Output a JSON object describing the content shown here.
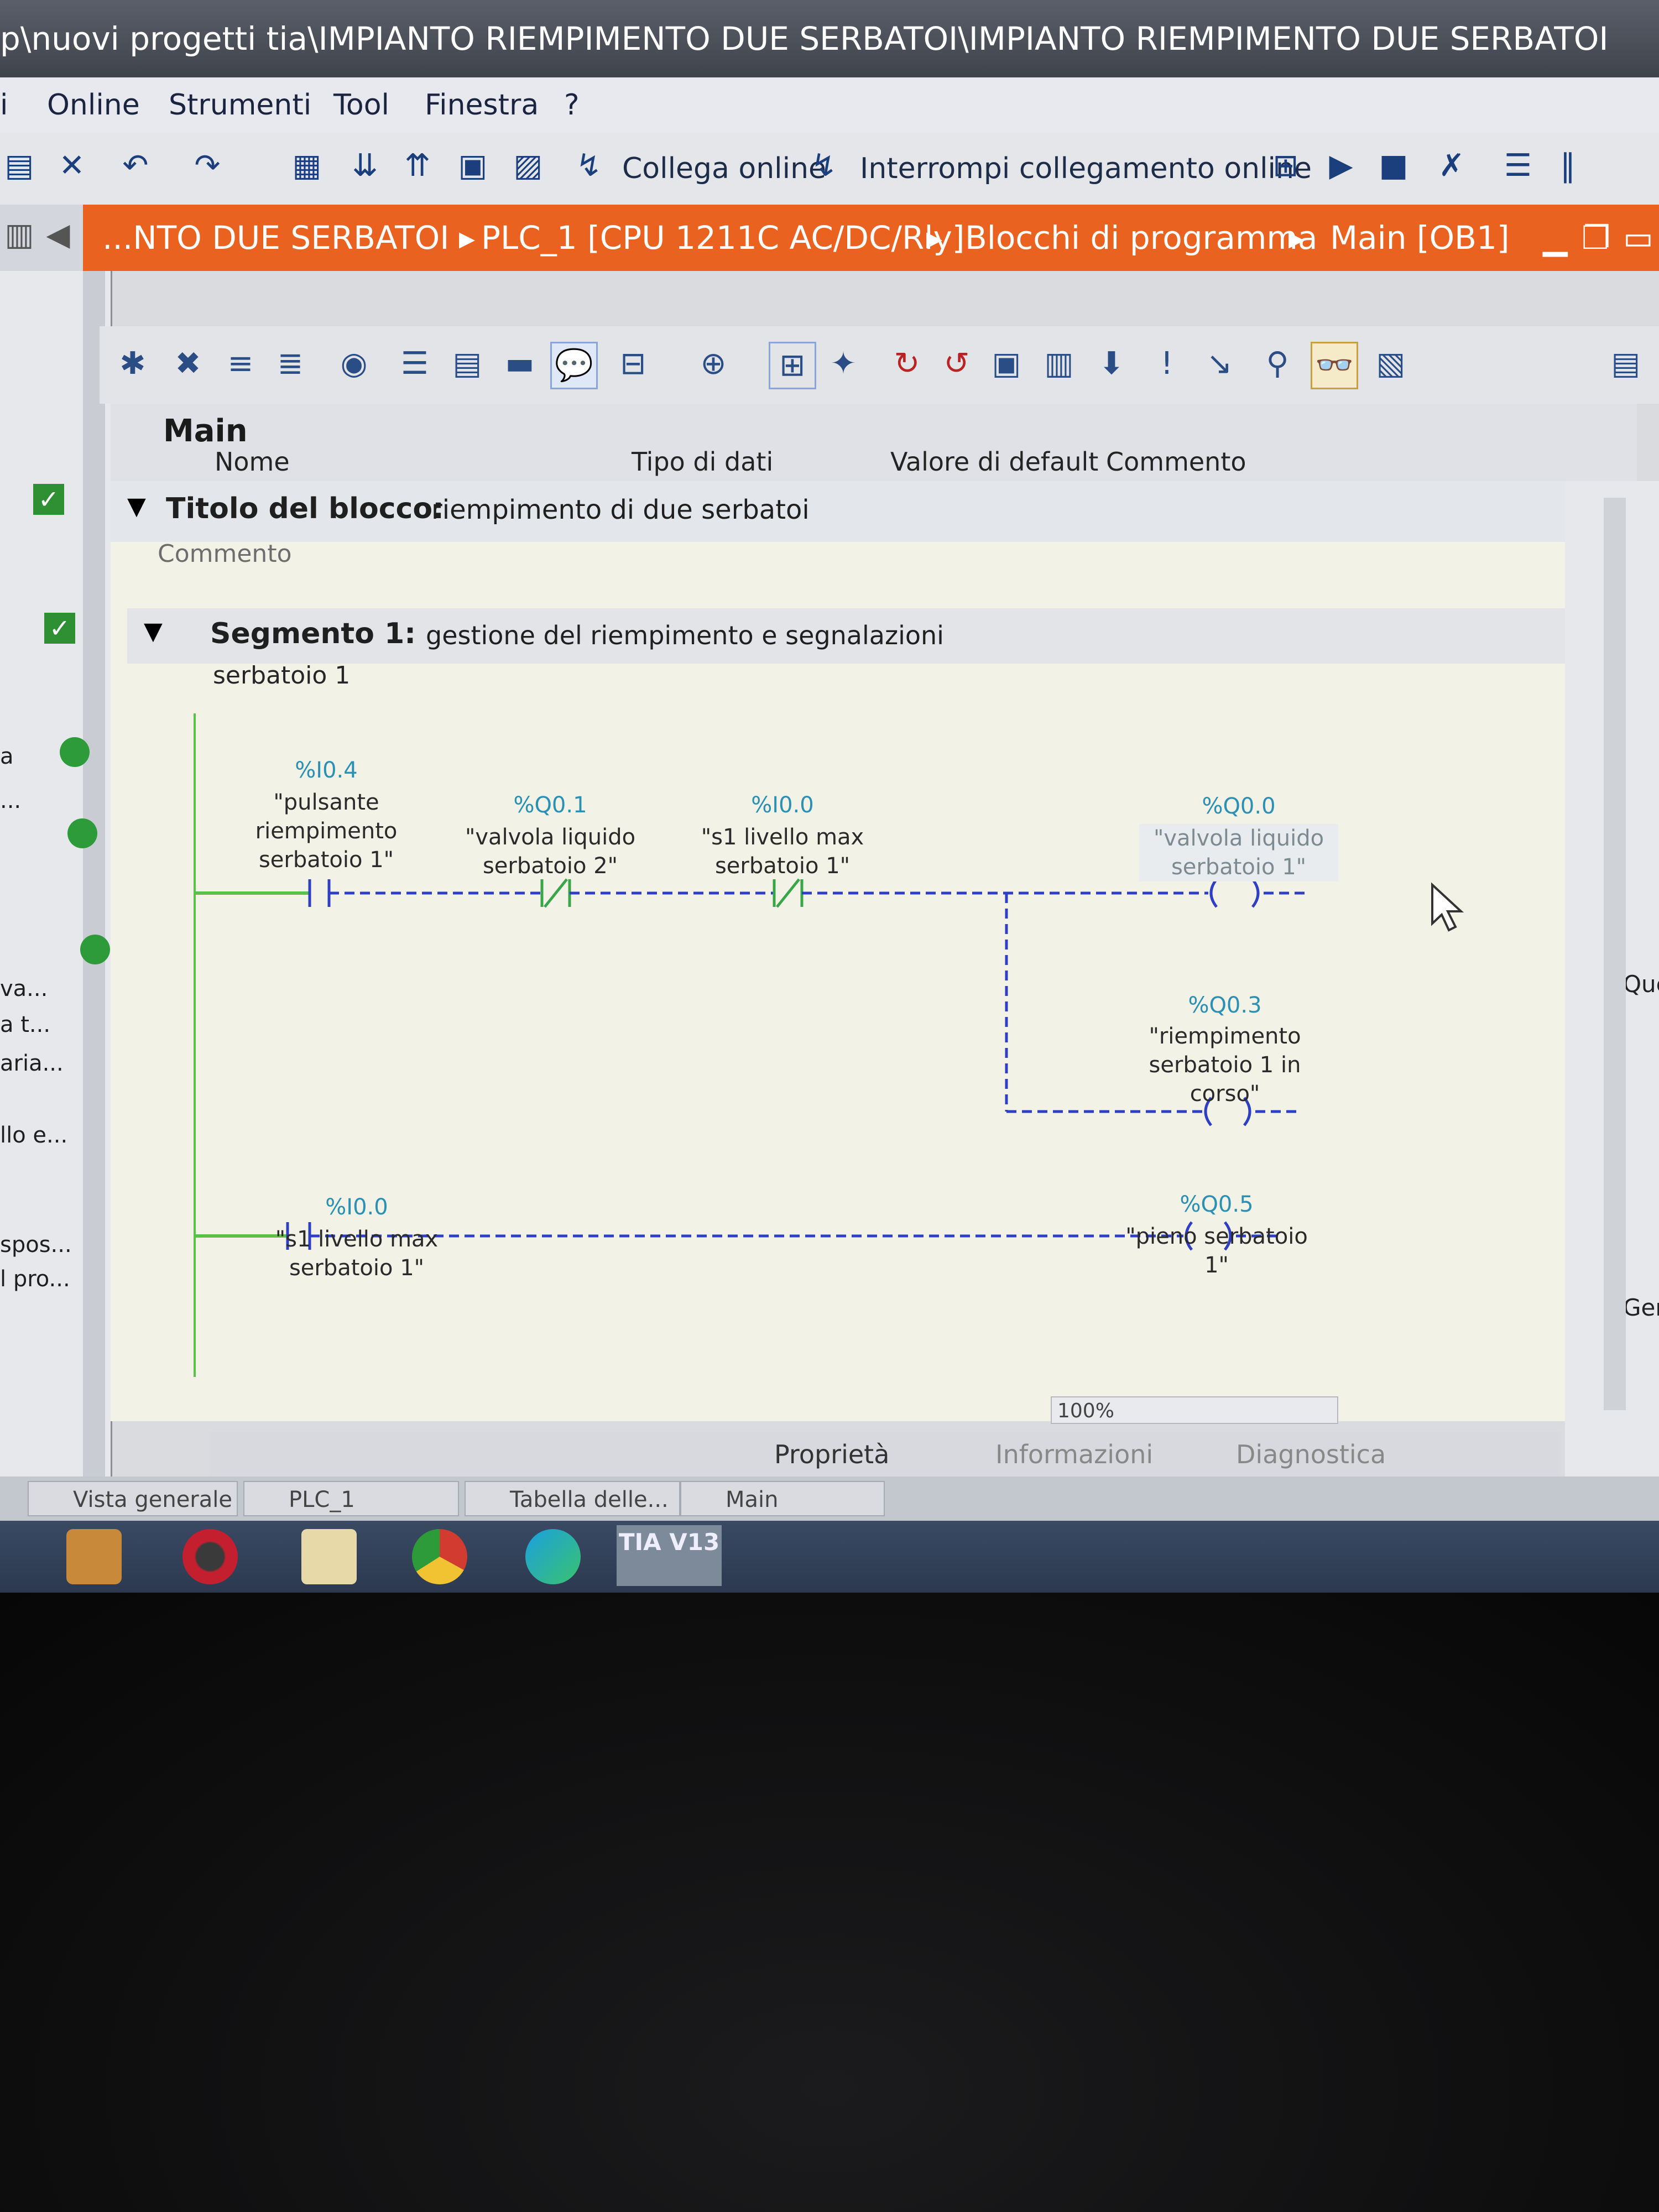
{
  "window": {
    "title": "p\\nuovi progetti tia\\IMPIANTO RIEMPIMENTO DUE SERBATOI\\IMPIANTO RIEMPIMENTO DUE SERBATOI"
  },
  "menu": {
    "items": [
      "i",
      "Online",
      "Strumenti",
      "Tool",
      "Finestra",
      "?"
    ]
  },
  "toolbar": {
    "go_online_label": "Collega online",
    "go_offline_label": "Interrompi collegamento online"
  },
  "breadcrumb": {
    "items": [
      "...NTO DUE SERBATOI",
      "PLC_1 [CPU 1211C AC/DC/Rly]",
      "Blocchi di programma",
      "Main [OB1]"
    ]
  },
  "interface": {
    "title": "Main",
    "columns": [
      "Nome",
      "Tipo di dati",
      "Valore di default",
      "Commento"
    ]
  },
  "block": {
    "title_label": "Titolo del blocco:",
    "title_value": "riempimento di due serbatoi",
    "comment": "Commento"
  },
  "segment": {
    "label": "Segmento 1:",
    "title": "gestione del riempimento e segnalazioni",
    "comment": "serbatoio 1"
  },
  "ladder": {
    "rung1": {
      "contact1": {
        "address": "%I0.4",
        "name": "\"pulsante riempimento serbatoio 1\""
      },
      "contact2": {
        "address": "%Q0.1",
        "name": "\"valvola liquido serbatoio 2\""
      },
      "contact3": {
        "address": "%I0.0",
        "name": "\"s1 livello max serbatoio 1\""
      },
      "coil1": {
        "address": "%Q0.0",
        "name": "\"valvola liquido serbatoio 1\""
      },
      "coil2": {
        "address": "%Q0.3",
        "name": "\"riempimento serbatoio 1 in corso\""
      }
    },
    "rung2": {
      "contact1": {
        "address": "%I0.0",
        "name": "\"s1 livello max serbatoio 1\""
      },
      "coil1": {
        "address": "%Q0.5",
        "name": "\"pieno serbatoio 1\""
      }
    }
  },
  "zoom": "100%",
  "inspector_tabs": [
    "Proprietà",
    "Informazioni",
    "Diagnostica"
  ],
  "portal_tabs": [
    "Vista generale",
    "PLC_1",
    "Tabella delle...",
    "Main"
  ],
  "left_panel": {
    "items": [
      "a",
      "...",
      "va...",
      "a t...",
      "aria...",
      "llo e...",
      "spos...",
      "l pro..."
    ]
  },
  "right_panel": {
    "items": [
      "Que",
      "Ger"
    ]
  },
  "taskbar": {
    "tia_label": "TIA V13"
  },
  "colors": {
    "breadcrumb": "#e9621f",
    "address": "#2c8fb4",
    "power_rail": "#5bc04a",
    "ladder_wire": "#2f3fc4",
    "status_ok": "#2e9b3a"
  }
}
